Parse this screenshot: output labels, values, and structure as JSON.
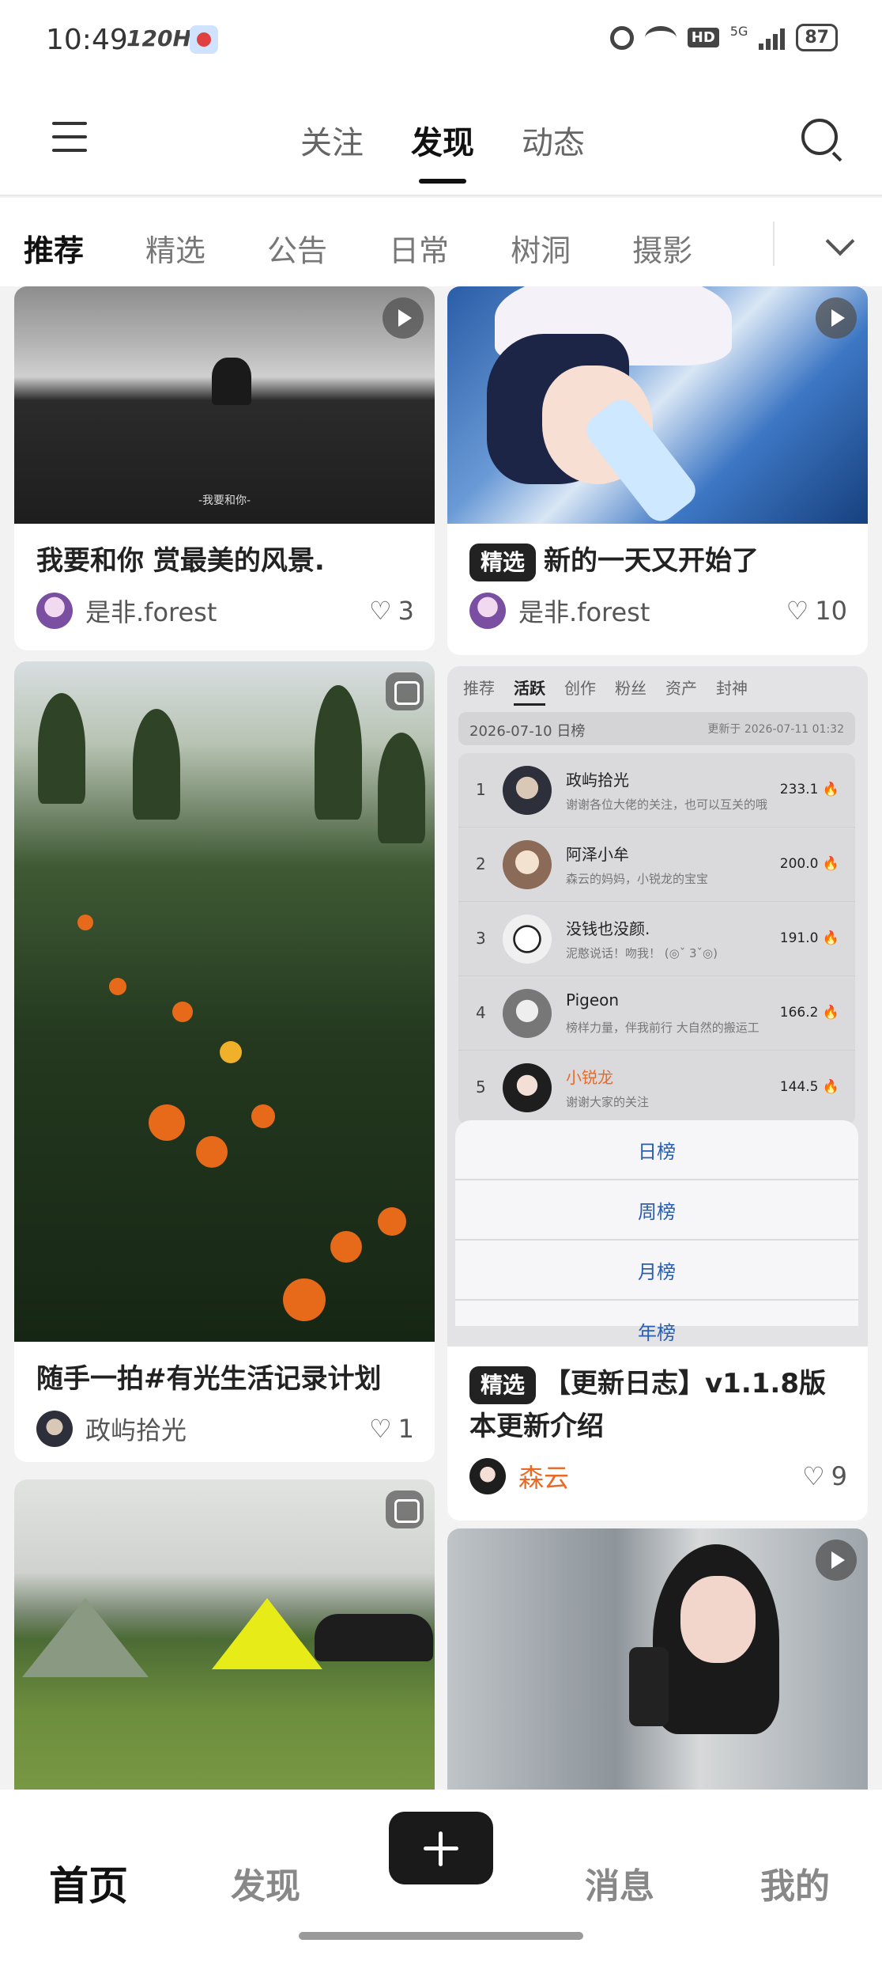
{
  "status_bar": {
    "time": "10:49",
    "refresh": "120Hz",
    "network": "5G",
    "battery": "87"
  },
  "top_nav": {
    "tabs": [
      "关注",
      "发现",
      "动态"
    ],
    "active_tab": "发现"
  },
  "categories": {
    "items": [
      "推荐",
      "精选",
      "公告",
      "日常",
      "树洞",
      "摄影"
    ],
    "active": "推荐"
  },
  "cards": [
    {
      "title": "我要和你 赏最美的风景.",
      "author": "是非.forest",
      "likes": "3",
      "media": "video",
      "image_caption": "-我要和你-"
    },
    {
      "badge": "精选",
      "title": "新的一天又开始了",
      "author": "是非.forest",
      "likes": "10",
      "media": "video"
    },
    {
      "title": "随手一拍#有光生活记录计划",
      "author": "政屿拾光",
      "likes": "1",
      "media": "image"
    },
    {
      "badge": "精选",
      "title": "【更新日志】v1.1.8版本更新介绍",
      "author": "森云",
      "likes": "9",
      "media": "image"
    },
    {
      "media": "image"
    },
    {
      "media": "video"
    }
  ],
  "ranking_image": {
    "tabs": [
      "推荐",
      "活跃",
      "创作",
      "粉丝",
      "资产",
      "封神"
    ],
    "active_tab": "活跃",
    "date": "2026-07-10 日榜",
    "updated": "更新于 2026-07-11 01:32",
    "rows": [
      {
        "rank": "1",
        "name": "政屿拾光",
        "sub": "谢谢各位大佬的关注，也可以互关的哦",
        "score": "233.1 🔥"
      },
      {
        "rank": "2",
        "name": "阿泽小牟",
        "sub": "森云的妈妈，小锐龙的宝宝",
        "score": "200.0 🔥"
      },
      {
        "rank": "3",
        "name": "没钱也没颜.",
        "sub": "泥憨说话！吻我！ (◎ˇ 3ˇ◎)",
        "score": "191.0 🔥"
      },
      {
        "rank": "4",
        "name": "Pigeon",
        "sub": "榜样力量，伴我前行 大自然的搬运工",
        "score": "166.2 🔥"
      },
      {
        "rank": "5",
        "name": "小锐龙",
        "sub": "谢谢大家的关注",
        "score": "144.5 🔥"
      }
    ],
    "sheet_options": [
      "日榜",
      "周榜",
      "月榜",
      "年榜"
    ]
  },
  "bottom_nav": {
    "items": [
      "首页",
      "发现",
      "消息",
      "我的"
    ],
    "active": "首页"
  },
  "colors": {
    "accent_dark": "#1a1a1a",
    "author_highlight": "#e86a28",
    "link_blue": "#2a5fb0"
  }
}
